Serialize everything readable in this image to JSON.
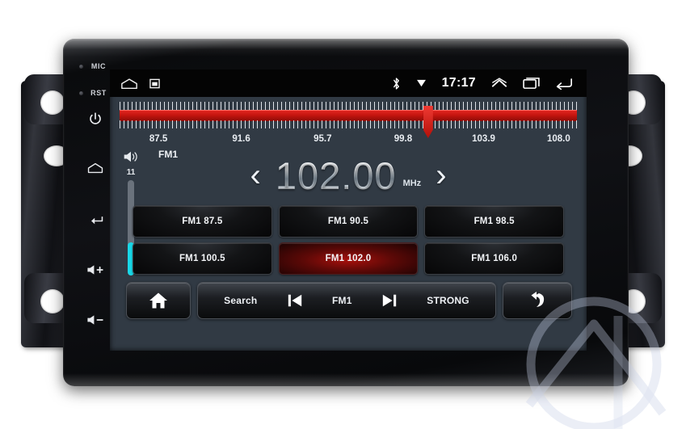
{
  "device": {
    "name": "car-head-unit",
    "side_keys": [
      {
        "id": "mic",
        "label": "MIC"
      },
      {
        "id": "rst",
        "label": "RST"
      },
      {
        "id": "power",
        "label": "power-icon"
      },
      {
        "id": "home",
        "label": "home-icon"
      },
      {
        "id": "back",
        "label": "back-icon"
      },
      {
        "id": "volume-up",
        "label": "volume-up-icon"
      },
      {
        "id": "volume-down",
        "label": "volume-down-icon"
      }
    ]
  },
  "status_bar": {
    "home_icon": "home-icon",
    "screenshot_icon": "screenshot-icon",
    "bluetooth_icon": "bluetooth-icon",
    "signal_icon": "signal-down-icon",
    "clock": "17:17",
    "expand_icon": "chevron-up-icon",
    "recents_icon": "recent-apps-icon",
    "back_icon": "back-arrow-icon"
  },
  "tuner": {
    "scale_labels": [
      "87.5",
      "91.6",
      "95.7",
      "99.8",
      "103.9",
      "108.0"
    ],
    "scale_min": 87.5,
    "scale_max": 108.0,
    "cursor_frequency": 102.0,
    "bar_color": "#c3150f",
    "cursor_color": "#ef3a33"
  },
  "volume": {
    "icon": "speaker-icon",
    "value": "11",
    "percent": 35,
    "fill_color": "#18d8e8"
  },
  "radio": {
    "band": "FM1",
    "frequency": "102.00",
    "unit": "MHz",
    "prev_chevron": "‹",
    "next_chevron": "›"
  },
  "presets": [
    {
      "label": "FM1 87.5",
      "active": false
    },
    {
      "label": "FM1 90.5",
      "active": false
    },
    {
      "label": "FM1 98.5",
      "active": false
    },
    {
      "label": "FM1 100.5",
      "active": false
    },
    {
      "label": "FM1 102.0",
      "active": true
    },
    {
      "label": "FM1 106.0",
      "active": false
    }
  ],
  "toolbar": {
    "home_icon": "home-icon",
    "search_label": "Search",
    "prev_icon": "skip-previous-icon",
    "band_label": "FM1",
    "next_icon": "skip-next-icon",
    "strong_label": "STRONG",
    "return_icon": "return-arrow-icon"
  }
}
